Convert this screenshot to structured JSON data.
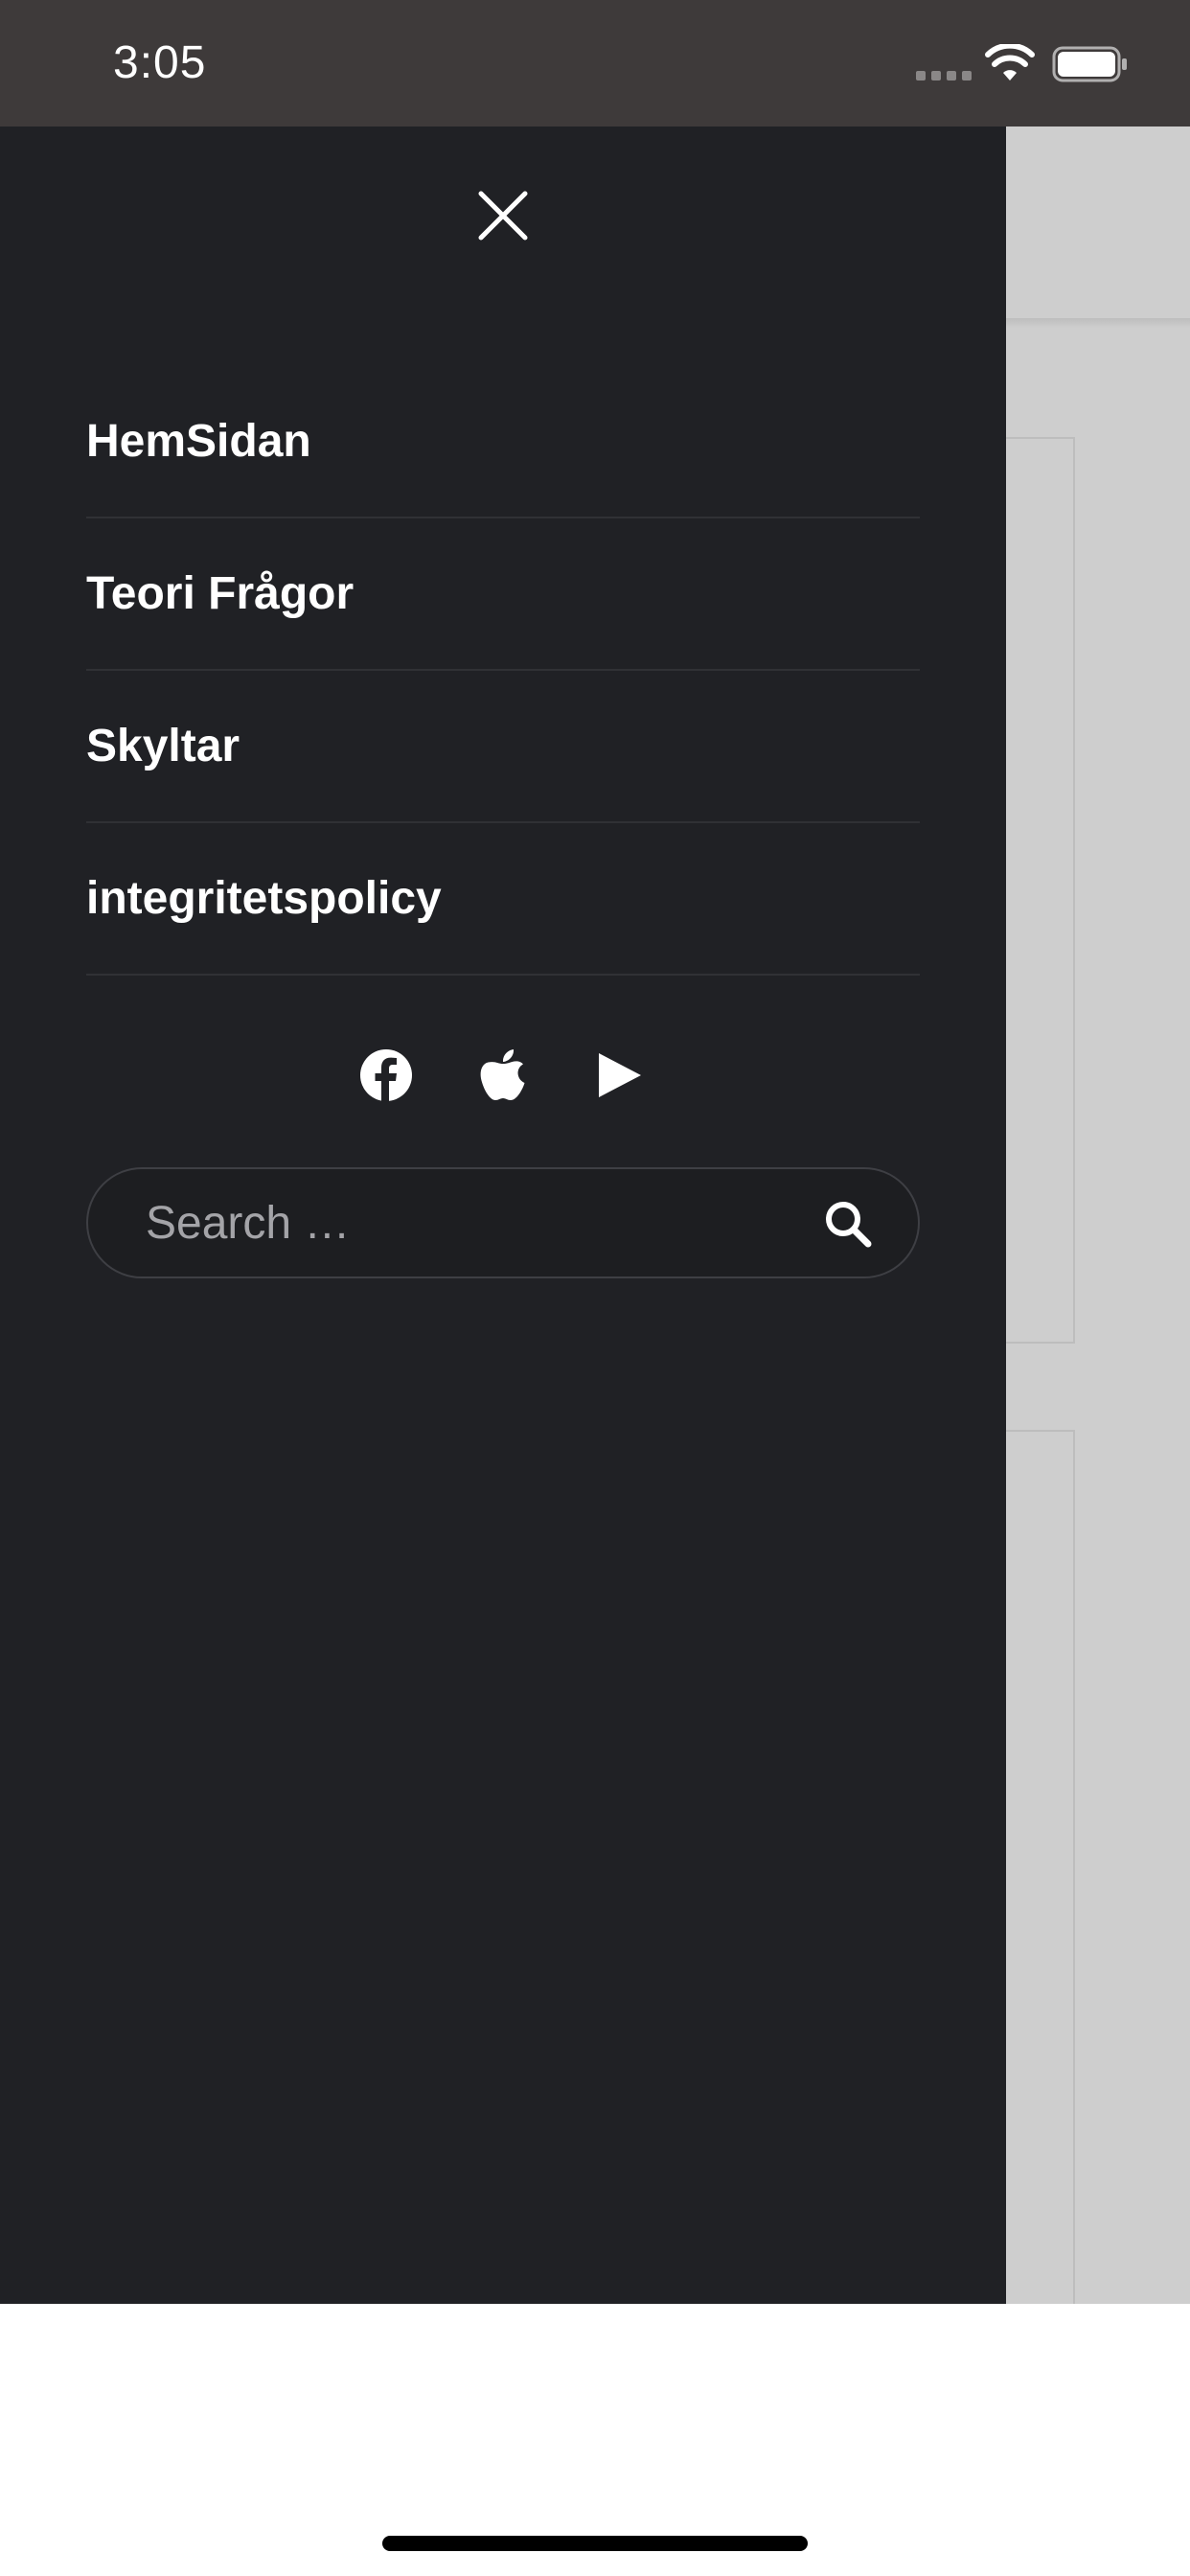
{
  "status_bar": {
    "time": "3:05"
  },
  "drawer": {
    "close_icon": "close-icon",
    "nav_items": [
      {
        "label": "HemSidan"
      },
      {
        "label": "Teori Frågor"
      },
      {
        "label": "Skyltar"
      },
      {
        "label": "integritetspolicy"
      }
    ],
    "social": [
      {
        "icon": "facebook-icon"
      },
      {
        "icon": "apple-icon"
      },
      {
        "icon": "play-store-icon"
      }
    ],
    "search": {
      "placeholder": "Search …",
      "value": "",
      "icon": "search-icon"
    }
  },
  "colors": {
    "status_bar_bg": "#3e3a3a",
    "drawer_bg": "#202125",
    "content_bg": "#cecece",
    "text": "#ffffff",
    "placeholder": "#a4a4a8"
  }
}
